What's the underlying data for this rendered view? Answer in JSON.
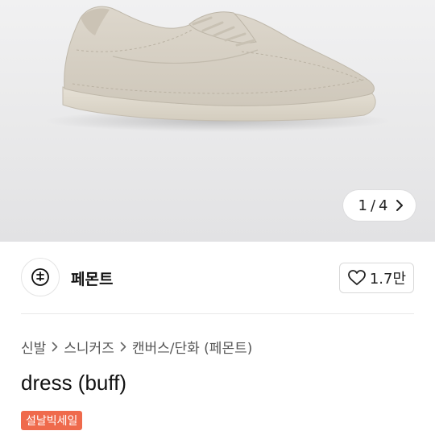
{
  "gallery": {
    "current": "1",
    "separator": "/",
    "total": "4",
    "next_icon": "chevron-right-icon"
  },
  "store": {
    "logo_icon": "store-logo-icon",
    "name": "페몬트",
    "like_icon": "heart-outline-icon",
    "likes": "1.7만"
  },
  "breadcrumb": {
    "items": [
      "신발",
      "스니커즈",
      "캔버스/단화 (페몬트)"
    ],
    "separator_icon": "chevron-right-icon"
  },
  "product": {
    "title": "dress (buff)",
    "badge": "설날빅세일"
  },
  "colors": {
    "badge_bg": "#ef6a4c",
    "shoe": "#d6d0c4",
    "hero_bg": "#ebebec"
  }
}
